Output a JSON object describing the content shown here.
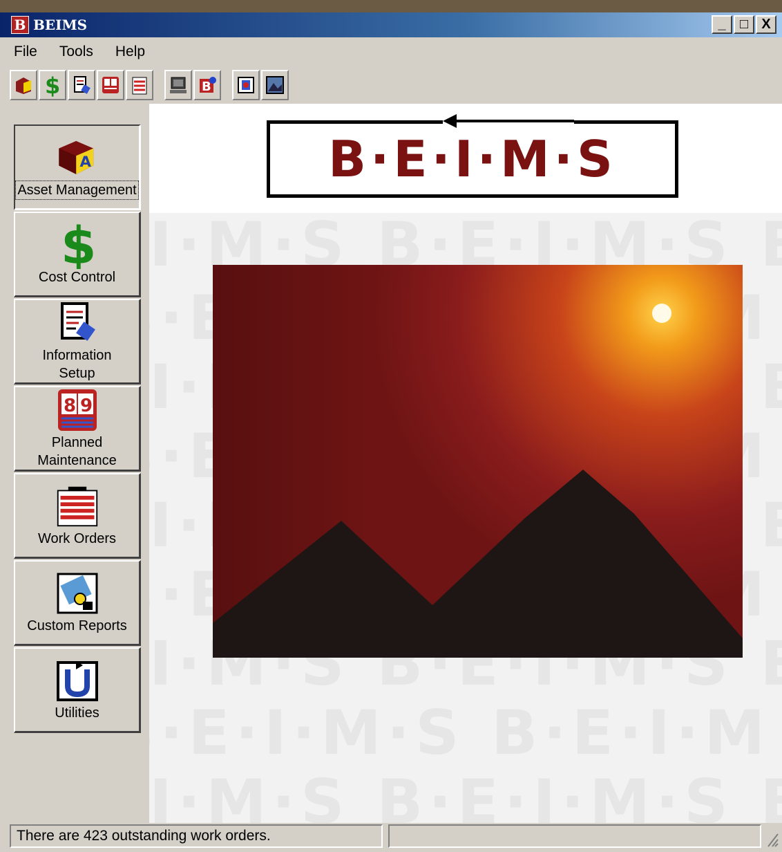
{
  "window": {
    "title": "BEIMS",
    "app_icon_letter": "B",
    "minimize": "_",
    "maximize": "□",
    "close": "X"
  },
  "menu": [
    "File",
    "Tools",
    "Help"
  ],
  "toolbar_icons": [
    "asset-management-icon",
    "cost-control-icon",
    "information-setup-icon",
    "planned-maintenance-icon",
    "work-orders-icon",
    "computer-icon",
    "beims-icon",
    "report-icon",
    "image-icon"
  ],
  "sidebar": {
    "items": [
      {
        "label": "Asset Management",
        "icon": "asset-cube-icon",
        "active": true
      },
      {
        "label": "Cost Control",
        "icon": "dollar-icon"
      },
      {
        "label": "Information Setup",
        "icon": "document-icon"
      },
      {
        "label": "Planned Maintenance",
        "icon": "calendar-icon"
      },
      {
        "label": "Work Orders",
        "icon": "clipboard-icon"
      },
      {
        "label": "Custom Reports",
        "icon": "report-icon"
      },
      {
        "label": "Utilities",
        "icon": "utilities-icon"
      }
    ]
  },
  "logo": {
    "text": "B·E·I·M·S",
    "color": "#7a1212"
  },
  "watermark": [
    "I·M·S B·E·I·M·S B·E",
    "B·E·I·M·S B·E·I·M",
    "I·M·S B·E·I·M·S B·E"
  ],
  "status": {
    "message": "There are 423 outstanding work orders.",
    "secondary": ""
  }
}
